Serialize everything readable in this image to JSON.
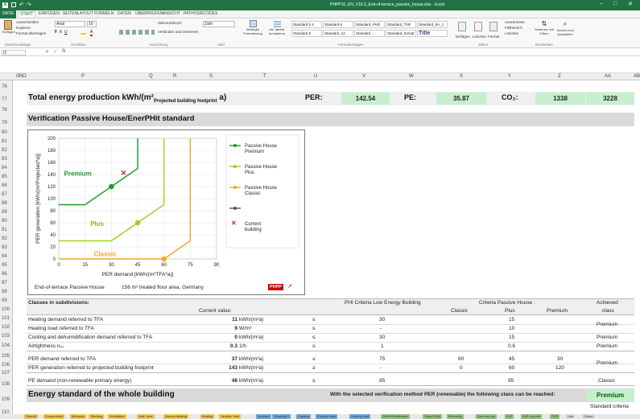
{
  "window": {
    "title": "PHPP10_EN_V10.3_End-of-terrace_passive_house.xlsx - Excel"
  },
  "ribbon_tabs": [
    "DATEI",
    "START",
    "EINFÜGEN",
    "SEITENLAYOUT",
    "FORMELN",
    "DATEN",
    "ÜBERPRÜFEN",
    "ANSICHT",
    "PATHOS/ECODES"
  ],
  "ribbon": {
    "clipboard": {
      "paste": "Einfügen",
      "cut": "Ausschneiden",
      "copy": "Kopieren",
      "format_painter": "Format übertragen",
      "group": "Zwischenablage"
    },
    "font": {
      "name": "Arial",
      "size": "10",
      "group": "Schriftart"
    },
    "alignment": {
      "wrap": "Zeilenumbruch",
      "merge": "Verbinden und zentrieren",
      "group": "Ausrichtung"
    },
    "number": {
      "format": "Zahl",
      "group": "Zahl"
    },
    "styles": {
      "cond": "Bedingte Formatierung",
      "table": "Als Tabelle formatieren",
      "cells": [
        "Standard 5 4",
        "Standard 6",
        "Standard_PHD",
        "Standard_TNF",
        "Standard_5A_1",
        "Standard 8",
        "Standard_12",
        "Standard ...",
        "Standard_format",
        "Title"
      ],
      "group": "Formatvorlagen"
    },
    "cells": {
      "insert": "Einfügen",
      "delete": "Löschen",
      "format": "Format",
      "group": "Zellen"
    },
    "editing": {
      "autosum": "AutoSumme",
      "fill": "Füllbereich",
      "clear": "Löschen",
      "sort": "Sortieren und Filtern",
      "find": "Suchen und Auswählen",
      "group": "Bearbeiten"
    }
  },
  "formula_bar": {
    "name_box": "I2",
    "fx": "fx"
  },
  "columns": [
    "G",
    "N",
    "O",
    "P",
    "Q",
    "R",
    "S",
    "T",
    "U",
    "V",
    "W",
    "X",
    "Y",
    "Z",
    "AA",
    "AB"
  ],
  "rows": [
    "76",
    "77",
    "78",
    "79",
    "80",
    "81",
    "82",
    "83",
    "84",
    "85",
    "86",
    "87",
    "88",
    "89",
    "90",
    "91",
    "92",
    "93",
    "94",
    "95",
    "96",
    "97",
    "98",
    "99",
    "100",
    "101",
    "102",
    "103",
    "104",
    "105",
    "106",
    "107",
    "108",
    "109",
    "110"
  ],
  "energy": {
    "title": "Total energy production kWh/(m²",
    "title_sub": "Projected building footprint",
    "title_end": " a)",
    "per_label": "PER:",
    "per_value": "142.54",
    "pe_label": "PE:",
    "pe_value": "35.87",
    "co2_label": "CO₂:",
    "co2_value": "1338",
    "last_value": "3228"
  },
  "verification_title": "Verification Passive House/EnerPHit standard",
  "chart_data": {
    "type": "line",
    "xlabel": "PER demand [kWh/(m²TFA*a)]",
    "ylabel": "PER generation [kWh/(m²Projected*a)]",
    "xticks": [
      0,
      15,
      30,
      45,
      60,
      75,
      90
    ],
    "yticks": [
      0,
      20,
      40,
      60,
      80,
      100,
      120,
      140,
      160,
      180,
      200
    ],
    "xlim": [
      0,
      90
    ],
    "ylim": [
      0,
      200
    ],
    "series": [
      {
        "name": "Passive House Premium",
        "color": "#1a9a2a",
        "points": [
          [
            0,
            90
          ],
          [
            15,
            90
          ],
          [
            30,
            120
          ],
          [
            45,
            150
          ],
          [
            45,
            200
          ]
        ]
      },
      {
        "name": "Passive House Plus",
        "color": "#a0d020",
        "points": [
          [
            0,
            30
          ],
          [
            30,
            30
          ],
          [
            45,
            60
          ],
          [
            60,
            90
          ],
          [
            60,
            200
          ]
        ]
      },
      {
        "name": "Passive House Classic",
        "color": "#f5a623",
        "points": [
          [
            0,
            0
          ],
          [
            60,
            0
          ],
          [
            75,
            30
          ],
          [
            75,
            200
          ]
        ]
      }
    ],
    "markers": [
      {
        "series": "Premium",
        "x": 30,
        "y": 120,
        "color": "#1a9a2a"
      },
      {
        "series": "Plus",
        "x": 45,
        "y": 60,
        "color": "#a0d020"
      },
      {
        "series": "Classic",
        "x": 60,
        "y": 0,
        "color": "#f5a623"
      }
    ],
    "current_building": {
      "x": 37,
      "y": 143,
      "color": "#cc2222"
    },
    "region_labels": [
      {
        "text": "Premium",
        "x": 3,
        "y": 138,
        "color": "#1a9a2a"
      },
      {
        "text": "Plus",
        "x": 18,
        "y": 55,
        "color": "#8ab820"
      },
      {
        "text": "Classic",
        "x": 20,
        "y": 5,
        "color": "#f5a623"
      }
    ],
    "legend": [
      {
        "label": "Passive House Premium",
        "color": "#1a9a2a"
      },
      {
        "label": "Passive House Plus",
        "color": "#a0d020"
      },
      {
        "label": "Passive House Classic",
        "color": "#f5a623"
      },
      {
        "label": "",
        "color": "#555"
      },
      {
        "label": "Current building",
        "color": "#cc2222"
      }
    ],
    "footer_left": "End-of-terrace Passive House",
    "footer_mid": "156 m² treated floor area, Germany",
    "logo": "PHPP"
  },
  "classes": {
    "title": "Classes in subdivisions:",
    "current_value": "Current value:",
    "phi_low": "PHI Criteria Low Energy Building",
    "criteria_ph": "Criteria Passive House :",
    "classic": "Classic",
    "plus": "Plus",
    "premium": "Premium",
    "achieved": "Achieved",
    "achieved2": "class",
    "rows": [
      {
        "label": "Heating demand referred to TFA",
        "value": "11",
        "unit": "kWh/(m²a)",
        "op": "≤",
        "low": "30",
        "c": "15",
        "p": "",
        "pr": "",
        "ach": ""
      },
      {
        "label": "Heating load referred to TFA",
        "value": "9",
        "unit": "W/m²",
        "op": "≤",
        "low": "-",
        "c": "10",
        "p": "",
        "pr": "",
        "ach": "Premium"
      },
      {
        "label": "Cooling and dehumidification demand referred to TFA",
        "value": "0",
        "unit": "kWh/(m²a)",
        "op": "≤",
        "low": "30",
        "c": "15",
        "p": "",
        "pr": "",
        "ach": "Premium"
      },
      {
        "label": "Airtightness n₅₀",
        "value": "0.3",
        "unit": "1/h",
        "op": "≤",
        "low": "1",
        "c": "0.6",
        "p": "",
        "pr": "",
        "ach": "Premium"
      }
    ],
    "per_rows": [
      {
        "label": "PER demand referred to TFA",
        "value": "37",
        "unit": "kWh/(m²a)",
        "op": "≤",
        "low": "75",
        "c": "60",
        "p": "45",
        "pr": "30"
      },
      {
        "label": "PER generation referred to projected building footprint",
        "value": "143",
        "unit": "kWh/(m²a)",
        "op": "≥",
        "low": "-",
        "c": "0",
        "p": "60",
        "pr": "120"
      }
    ],
    "per_ach": "Premium",
    "pe_row": {
      "label": "PE demand (non-renewable primary energy)",
      "value": "48",
      "unit": "kWh/(m²a)",
      "op": "≤",
      "low": "95",
      "c": "95",
      "ach": "Classic"
    }
  },
  "energy_standard": {
    "title": "Energy standard of the whole building",
    "text": "With the selected verification method PER (renewable) the following class can be reached:",
    "result": "Premium",
    "criteria": "Standard criteria"
  },
  "sheet_tabs": [
    "Overall",
    "Components",
    "Windows",
    "Shading",
    "Ventilation",
    "Add. vent.",
    "Annual heating",
    "Heating",
    "Ventilat. load",
    "Summer",
    "Shading-S",
    "Cooling",
    "Cooling units",
    "Cooling load",
    "DHW+Distribution",
    "Solar DHW",
    "Electricity",
    "Use non-res",
    "IHG",
    "IHG non-res",
    "PER",
    "Use",
    "Check"
  ]
}
